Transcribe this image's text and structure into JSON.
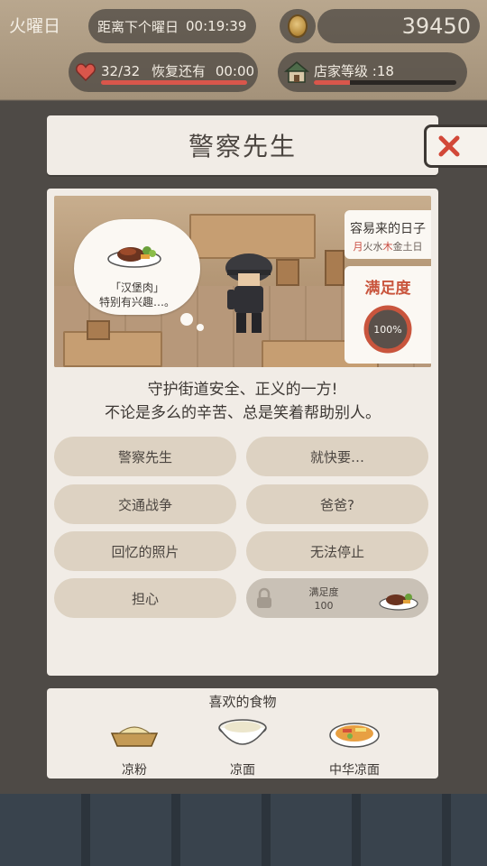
{
  "hud": {
    "day": "火曜日",
    "countdown_label": "距离下个曜日",
    "countdown_time": "00:19:39",
    "money": "39450",
    "hearts": "32/32",
    "recover_label": "恢复还有",
    "recover_time": "00:00",
    "hearts_fraction": 1.0,
    "shop_level_label": "店家等级 :18",
    "shop_level_progress": 0.25
  },
  "customer": {
    "name": "警察先生",
    "thought_line1": "「汉堡肉」",
    "thought_line2": "特别有兴趣…。",
    "favorite_day_title": "容易来的日子",
    "weekdays": [
      {
        "label": "月",
        "highlight": true
      },
      {
        "label": "火",
        "highlight": false
      },
      {
        "label": "水",
        "highlight": false
      },
      {
        "label": "木",
        "highlight": true
      },
      {
        "label": "金",
        "highlight": false
      },
      {
        "label": "土",
        "highlight": false
      },
      {
        "label": "日",
        "highlight": false
      }
    ],
    "satisfaction_title": "满足度",
    "satisfaction_value": "100%",
    "satisfaction_fraction": 1.0,
    "description_line1": "守护街道安全、正义的一方!",
    "description_line2": "不论是多么的辛苦、总是笑着帮助别人。"
  },
  "stories": [
    {
      "label": "警察先生"
    },
    {
      "label": "就快要…"
    },
    {
      "label": "交通战争"
    },
    {
      "label": "爸爸?"
    },
    {
      "label": "回忆的照片"
    },
    {
      "label": "无法停止"
    },
    {
      "label": "担心"
    }
  ],
  "locked_story": {
    "label": "满足度",
    "value": "100"
  },
  "favorite_foods": {
    "title": "喜欢的食物",
    "items": [
      {
        "name": "凉粉",
        "icon": "jelly-dish-icon"
      },
      {
        "name": "凉面",
        "icon": "cold-noodle-bowl-icon"
      },
      {
        "name": "中华凉面",
        "icon": "chinese-cold-noodle-icon"
      }
    ]
  },
  "colors": {
    "accent_red": "#c9553d",
    "panel": "#f1ece6",
    "button": "#ddd2c2"
  }
}
